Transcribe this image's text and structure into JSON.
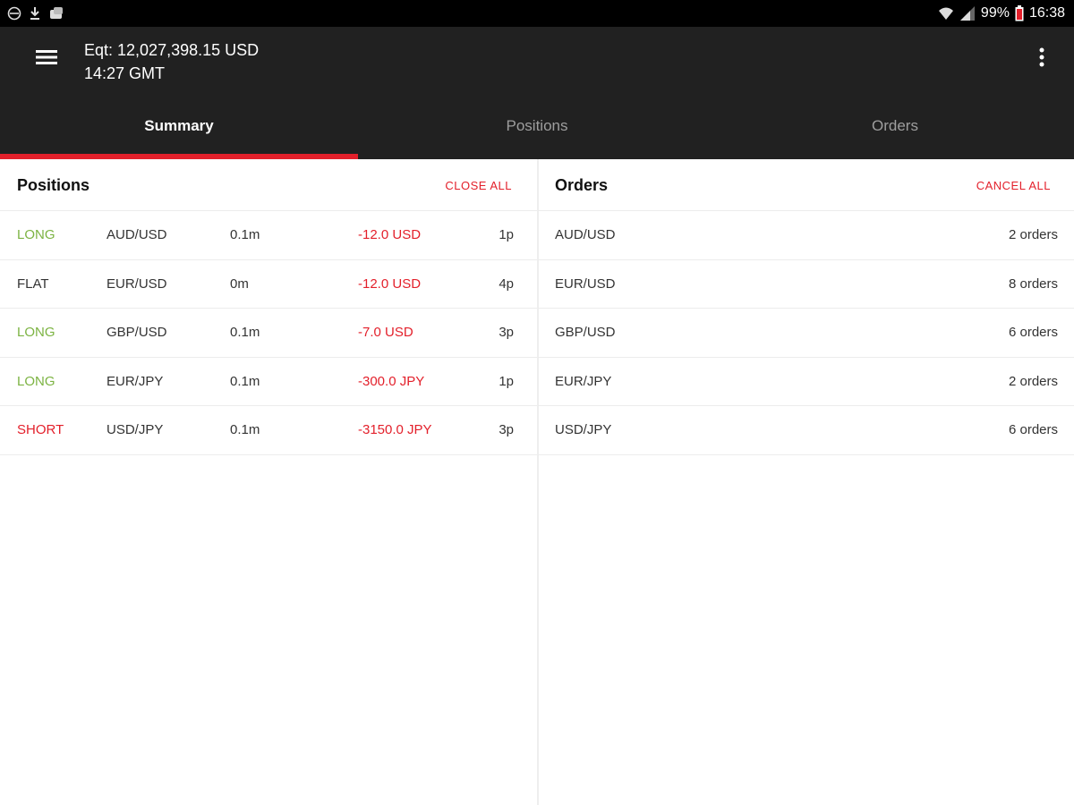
{
  "status_bar": {
    "battery": "99%",
    "time": "16:38",
    "icons": [
      "sync-icon",
      "download-icon",
      "app-notification-icon",
      "wifi-icon",
      "signal-icon",
      "battery-icon"
    ]
  },
  "app_bar": {
    "equity": "Eqt: 12,027,398.15 USD",
    "time": "14:27 GMT",
    "menu_icon": "hamburger-menu-icon",
    "overflow_icon": "more-vert-icon"
  },
  "tabs": [
    {
      "label": "Summary",
      "active": true
    },
    {
      "label": "Positions",
      "active": false
    },
    {
      "label": "Orders",
      "active": false
    }
  ],
  "positions_panel": {
    "title": "Positions",
    "action": "CLOSE ALL",
    "rows": [
      {
        "direction": "LONG",
        "pair": "AUD/USD",
        "size": "0.1m",
        "pl": "-12.0 USD",
        "pips": "1p"
      },
      {
        "direction": "FLAT",
        "pair": "EUR/USD",
        "size": "0m",
        "pl": "-12.0 USD",
        "pips": "4p"
      },
      {
        "direction": "LONG",
        "pair": "GBP/USD",
        "size": "0.1m",
        "pl": "-7.0 USD",
        "pips": "3p"
      },
      {
        "direction": "LONG",
        "pair": "EUR/JPY",
        "size": "0.1m",
        "pl": "-300.0 JPY",
        "pips": "1p"
      },
      {
        "direction": "SHORT",
        "pair": "USD/JPY",
        "size": "0.1m",
        "pl": "-3150.0 JPY",
        "pips": "3p"
      }
    ]
  },
  "orders_panel": {
    "title": "Orders",
    "action": "CANCEL ALL",
    "rows": [
      {
        "pair": "AUD/USD",
        "count": "2 orders"
      },
      {
        "pair": "EUR/USD",
        "count": "8 orders"
      },
      {
        "pair": "GBP/USD",
        "count": "6 orders"
      },
      {
        "pair": "EUR/JPY",
        "count": "2 orders"
      },
      {
        "pair": "USD/JPY",
        "count": "6 orders"
      }
    ]
  },
  "colors": {
    "accent_red": "#e3202b",
    "long_green": "#7cb342",
    "appbar_bg": "#212121"
  }
}
